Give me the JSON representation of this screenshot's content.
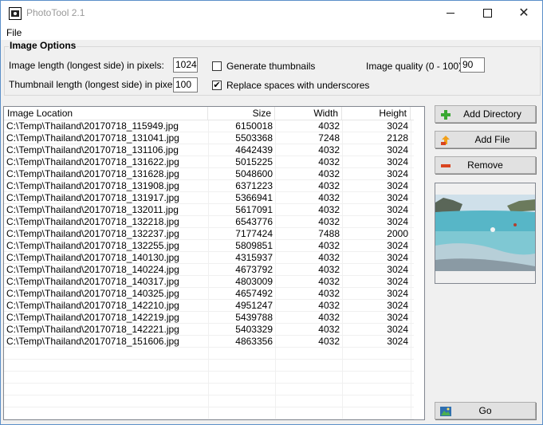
{
  "window": {
    "title": "PhotoTool 2.1"
  },
  "menu": {
    "file": "File"
  },
  "options": {
    "group_title": "Image Options",
    "image_length_label": "Image length (longest side) in pixels:",
    "image_length_value": "1024",
    "thumb_length_label": "Thumbnail length (longest side) in pixels:",
    "thumb_length_value": "100",
    "generate_thumbnails_label": "Generate thumbnails",
    "generate_thumbnails_checked": false,
    "replace_spaces_label": "Replace spaces with underscores",
    "replace_spaces_checked": true,
    "quality_label": "Image quality (0 - 100):",
    "quality_value": "90"
  },
  "table": {
    "headers": [
      "Image Location",
      "Size",
      "Width",
      "Height"
    ],
    "rows": [
      [
        "C:\\Temp\\Thailand\\20170718_115949.jpg",
        "6150018",
        "4032",
        "3024"
      ],
      [
        "C:\\Temp\\Thailand\\20170718_131041.jpg",
        "5503368",
        "7248",
        "2128"
      ],
      [
        "C:\\Temp\\Thailand\\20170718_131106.jpg",
        "4642439",
        "4032",
        "3024"
      ],
      [
        "C:\\Temp\\Thailand\\20170718_131622.jpg",
        "5015225",
        "4032",
        "3024"
      ],
      [
        "C:\\Temp\\Thailand\\20170718_131628.jpg",
        "5048600",
        "4032",
        "3024"
      ],
      [
        "C:\\Temp\\Thailand\\20170718_131908.jpg",
        "6371223",
        "4032",
        "3024"
      ],
      [
        "C:\\Temp\\Thailand\\20170718_131917.jpg",
        "5366941",
        "4032",
        "3024"
      ],
      [
        "C:\\Temp\\Thailand\\20170718_132011.jpg",
        "5617091",
        "4032",
        "3024"
      ],
      [
        "C:\\Temp\\Thailand\\20170718_132218.jpg",
        "6543776",
        "4032",
        "3024"
      ],
      [
        "C:\\Temp\\Thailand\\20170718_132237.jpg",
        "7177424",
        "7488",
        "2000"
      ],
      [
        "C:\\Temp\\Thailand\\20170718_132255.jpg",
        "5809851",
        "4032",
        "3024"
      ],
      [
        "C:\\Temp\\Thailand\\20170718_140130.jpg",
        "4315937",
        "4032",
        "3024"
      ],
      [
        "C:\\Temp\\Thailand\\20170718_140224.jpg",
        "4673792",
        "4032",
        "3024"
      ],
      [
        "C:\\Temp\\Thailand\\20170718_140317.jpg",
        "4803009",
        "4032",
        "3024"
      ],
      [
        "C:\\Temp\\Thailand\\20170718_140325.jpg",
        "4657492",
        "4032",
        "3024"
      ],
      [
        "C:\\Temp\\Thailand\\20170718_142210.jpg",
        "4951247",
        "4032",
        "3024"
      ],
      [
        "C:\\Temp\\Thailand\\20170718_142219.jpg",
        "5439788",
        "4032",
        "3024"
      ],
      [
        "C:\\Temp\\Thailand\\20170718_142221.jpg",
        "5403329",
        "4032",
        "3024"
      ],
      [
        "C:\\Temp\\Thailand\\20170718_151606.jpg",
        "4863356",
        "4032",
        "3024"
      ]
    ]
  },
  "buttons": {
    "add_directory": "Add Directory",
    "add_file": "Add File",
    "remove": "Remove",
    "go": "Go"
  },
  "icons": {
    "add_directory": "plus-icon",
    "add_file": "add-file-icon",
    "remove": "minus-icon",
    "go": "image-icon"
  },
  "colors": {
    "plus": "#3aa832",
    "minus": "#d9441f",
    "window_border": "#5b8fc9"
  }
}
